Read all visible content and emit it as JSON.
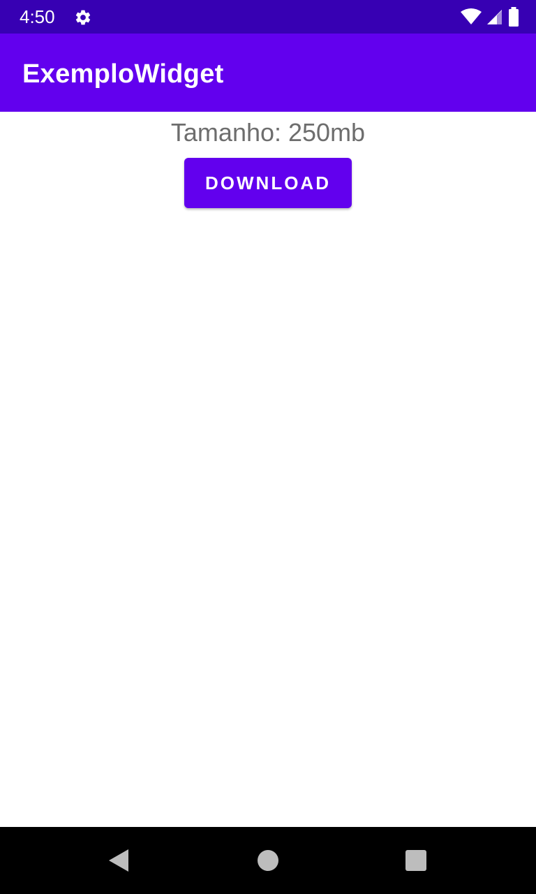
{
  "status_bar": {
    "time": "4:50",
    "icons": [
      "gear-icon",
      "wifi-icon",
      "cell-signal-icon",
      "battery-icon"
    ]
  },
  "app_bar": {
    "title": "ExemploWidget"
  },
  "main": {
    "size_label": "Tamanho: 250mb",
    "download_button_label": "DOWNLOAD"
  },
  "nav_bar": {
    "icons": [
      "back-icon",
      "home-icon",
      "recents-icon"
    ]
  },
  "colors": {
    "status_bar": "#3700b3",
    "primary": "#6200ee",
    "label_text": "#6d6d6d",
    "background": "#ffffff",
    "nav_bar": "#000000"
  }
}
